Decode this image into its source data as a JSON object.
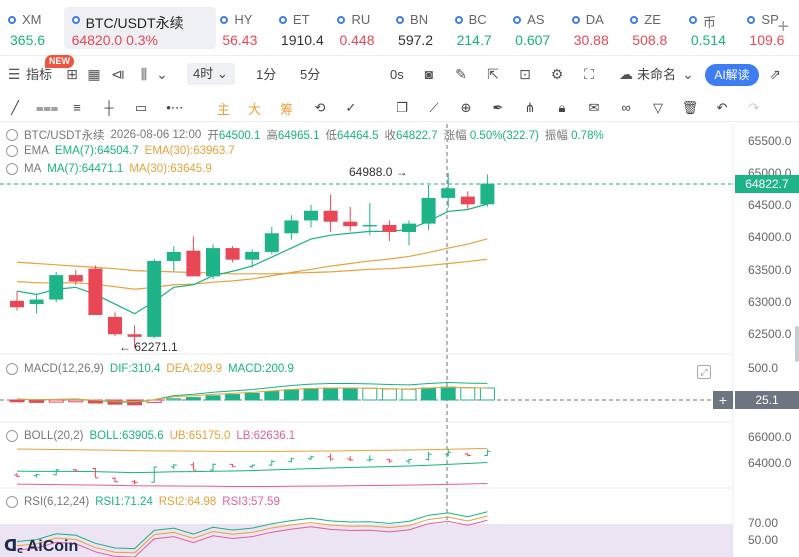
{
  "tickers": [
    {
      "symbol": "XM",
      "price": "365.6",
      "dir": "up"
    },
    {
      "symbol": "BTC/USDT永续",
      "price": "64820.0  0.3%",
      "dir": "down",
      "active": true
    },
    {
      "symbol": "HY",
      "price": "56.43",
      "dir": "down"
    },
    {
      "symbol": "ET",
      "price": "1910.4",
      "dir": "neutral"
    },
    {
      "symbol": "RU",
      "price": "0.448",
      "dir": "down"
    },
    {
      "symbol": "BN",
      "price": "597.2",
      "dir": "neutral"
    },
    {
      "symbol": "BC",
      "price": "214.7",
      "dir": "up"
    },
    {
      "symbol": "AS",
      "price": "0.607",
      "dir": "up"
    },
    {
      "symbol": "DA",
      "price": "30.88",
      "dir": "down"
    },
    {
      "symbol": "ZE",
      "price": "508.8",
      "dir": "down"
    },
    {
      "symbol": "币",
      "price": "0.514",
      "dir": "up"
    },
    {
      "symbol": "SP",
      "price": "109.6",
      "dir": "down"
    }
  ],
  "ticker_add": "+",
  "toolbar": {
    "indicator_label": "指标",
    "new_badge": "NEW",
    "interval_selected": "4时",
    "interval_1m": "1分",
    "interval_5m": "5分",
    "zero_s": "0s",
    "unnamed_label": "未命名",
    "ai_label": "AI解读"
  },
  "drawbar": {
    "main": "主",
    "big": "大",
    "chip": "筹"
  },
  "legend": {
    "pair": "BTC/USDT永续",
    "datetime": "2026-08-06 12:00",
    "open_label": "开",
    "open": "64500.1",
    "high_label": "高",
    "high": "64965.1",
    "low_label": "低",
    "low": "64464.5",
    "close_label": "收",
    "close": "64822.7",
    "change_label": "涨幅",
    "change": "0.50%(322.7)",
    "amp_label": "振幅",
    "amp": "0.78%",
    "ema_name": "EMA",
    "ema7": "EMA(7):64504.7",
    "ema30": "EMA(30):63963.7",
    "ma_name": "MA",
    "ma7": "MA(7):64471.1",
    "ma30": "MA(30):63645.9",
    "macd_name": "MACD(12,26,9)",
    "dif": "DIF:310.4",
    "dea": "DEA:209.9",
    "macd": "MACD:200.9",
    "boll_name": "BOLL(20,2)",
    "boll": "BOLL:63905.6",
    "ub": "UB:65175.0",
    "lb": "LB:62636.1",
    "rsi_name": "RSI(6,12,24)",
    "rsi1": "RSI1:71.24",
    "rsi2": "RSI2:64.98",
    "rsi3": "RSI3:57.59"
  },
  "annotations": {
    "high_marker": "64988.0",
    "low_marker": "62271.1"
  },
  "price_axis": [
    "65500.0",
    "65000.0",
    "64500.0",
    "64000.0",
    "63500.0",
    "63000.0",
    "62500.0"
  ],
  "current_price": "64822.7",
  "macd_axis": "500.0",
  "macd_crosshair": "25.1",
  "boll_axis": [
    "66000.0",
    "64000.0"
  ],
  "rsi_axis": [
    "70.00",
    "50.00"
  ],
  "logo": "AiCoin",
  "colors": {
    "up": "#19b183",
    "down": "#e84855",
    "accent": "#3d7cf1"
  },
  "chart_data": {
    "type": "candlestick",
    "candles": [
      {
        "o": 63000,
        "h": 63150,
        "l": 62850,
        "c": 62900
      },
      {
        "o": 62950,
        "h": 63100,
        "l": 62800,
        "c": 63020
      },
      {
        "o": 63020,
        "h": 63450,
        "l": 62980,
        "c": 63400
      },
      {
        "o": 63400,
        "h": 63480,
        "l": 63250,
        "c": 63300
      },
      {
        "o": 63500,
        "h": 63550,
        "l": 62800,
        "c": 62780
      },
      {
        "o": 62750,
        "h": 62820,
        "l": 62450,
        "c": 62480
      },
      {
        "o": 62480,
        "h": 62620,
        "l": 62271,
        "c": 62440
      },
      {
        "o": 62440,
        "h": 63650,
        "l": 62420,
        "c": 63620
      },
      {
        "o": 63620,
        "h": 63850,
        "l": 63460,
        "c": 63760
      },
      {
        "o": 63780,
        "h": 64000,
        "l": 63400,
        "c": 63380
      },
      {
        "o": 63380,
        "h": 63880,
        "l": 63340,
        "c": 63820
      },
      {
        "o": 63820,
        "h": 63850,
        "l": 63600,
        "c": 63640
      },
      {
        "o": 63640,
        "h": 63800,
        "l": 63520,
        "c": 63760
      },
      {
        "o": 63760,
        "h": 64150,
        "l": 63720,
        "c": 64050
      },
      {
        "o": 64050,
        "h": 64330,
        "l": 63950,
        "c": 64250
      },
      {
        "o": 64250,
        "h": 64490,
        "l": 64140,
        "c": 64400
      },
      {
        "o": 64400,
        "h": 64650,
        "l": 64070,
        "c": 64230
      },
      {
        "o": 64230,
        "h": 64460,
        "l": 64080,
        "c": 64160
      },
      {
        "o": 64160,
        "h": 64520,
        "l": 64020,
        "c": 64180
      },
      {
        "o": 64180,
        "h": 64250,
        "l": 63930,
        "c": 64070
      },
      {
        "o": 64070,
        "h": 64250,
        "l": 63860,
        "c": 64200
      },
      {
        "o": 64200,
        "h": 64800,
        "l": 64100,
        "c": 64600
      },
      {
        "o": 64600,
        "h": 64988,
        "l": 64450,
        "c": 64750
      },
      {
        "o": 64620,
        "h": 64700,
        "l": 64430,
        "c": 64500
      },
      {
        "o": 64500,
        "h": 64965,
        "l": 64464,
        "c": 64822
      }
    ],
    "ema7": [
      63150,
      63100,
      63180,
      63210,
      63100,
      62950,
      62800,
      62990,
      63210,
      63250,
      63390,
      63460,
      63540,
      63680,
      63820,
      63960,
      64020,
      64050,
      64080,
      64080,
      64110,
      64240,
      64390,
      64420,
      64505
    ],
    "ema30": [
      63300,
      63280,
      63280,
      63280,
      63260,
      63220,
      63180,
      63210,
      63250,
      63260,
      63290,
      63310,
      63340,
      63390,
      63440,
      63490,
      63540,
      63580,
      63620,
      63650,
      63690,
      63750,
      63820,
      63880,
      63964
    ],
    "ma30": [
      63600,
      63580,
      63560,
      63540,
      63520,
      63500,
      63470,
      63460,
      63450,
      63440,
      63430,
      63420,
      63420,
      63420,
      63430,
      63440,
      63450,
      63470,
      63490,
      63500,
      63520,
      63550,
      63580,
      63610,
      63646
    ],
    "macd_hist": [
      -30,
      -40,
      -35,
      -30,
      -50,
      -70,
      -80,
      -40,
      20,
      40,
      70,
      90,
      110,
      140,
      170,
      190,
      200,
      200,
      195,
      185,
      180,
      200,
      215,
      205,
      201
    ],
    "price_ylim": [
      62100,
      65700
    ]
  }
}
